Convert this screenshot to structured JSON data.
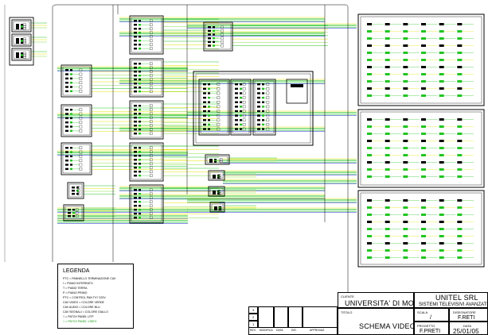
{
  "legend": {
    "title": "LEGENDA",
    "rows": [
      "PTC = PANNELLO TERMINAZIONE CAV",
      "I = PIANO INTERRATO",
      "T = PIANO TERRA",
      "P = PIANO PRIMO",
      "PTC = CONTROL PAN TV? 220V",
      "CAV VIDEO = COLORE VERDE",
      "CAV AUDIO = COLORE BLU",
      "CAV SEGNALI = COLORE GIALLO",
      "□ = PATCH PANEL UTP",
      "□ = PATCH PANEL VIDEO"
    ]
  },
  "title_block": {
    "cliente_label": "CLIENTE",
    "cliente_value": "UNIVERSITA' DI MODENA",
    "company_name": "UNITEL SRL",
    "company_sub": "SISTEMI TELEVISIVI AVANZATI",
    "titolo_label": "TITOLO",
    "titolo_value": "SCHEMA VIDEO",
    "scala_label": "SCALA",
    "scala_value": "/",
    "disegnatore_label": "DISEGNATORE",
    "disegnatore_value": "F.RETI",
    "progetto_label": "PROGETTO",
    "progetto_value": "F.PRETI",
    "data_label": "DATA",
    "data_value": "25/01/05",
    "revisions": [
      "3",
      "2",
      "1"
    ],
    "rev_headers": [
      "REV.",
      "MODIFICA",
      "DATA",
      "DIS.",
      "APPROVAZ."
    ]
  },
  "colors": {
    "video": "#22c422",
    "audio": "#2222dd",
    "signal": "#e6e600",
    "line": "#000000"
  }
}
